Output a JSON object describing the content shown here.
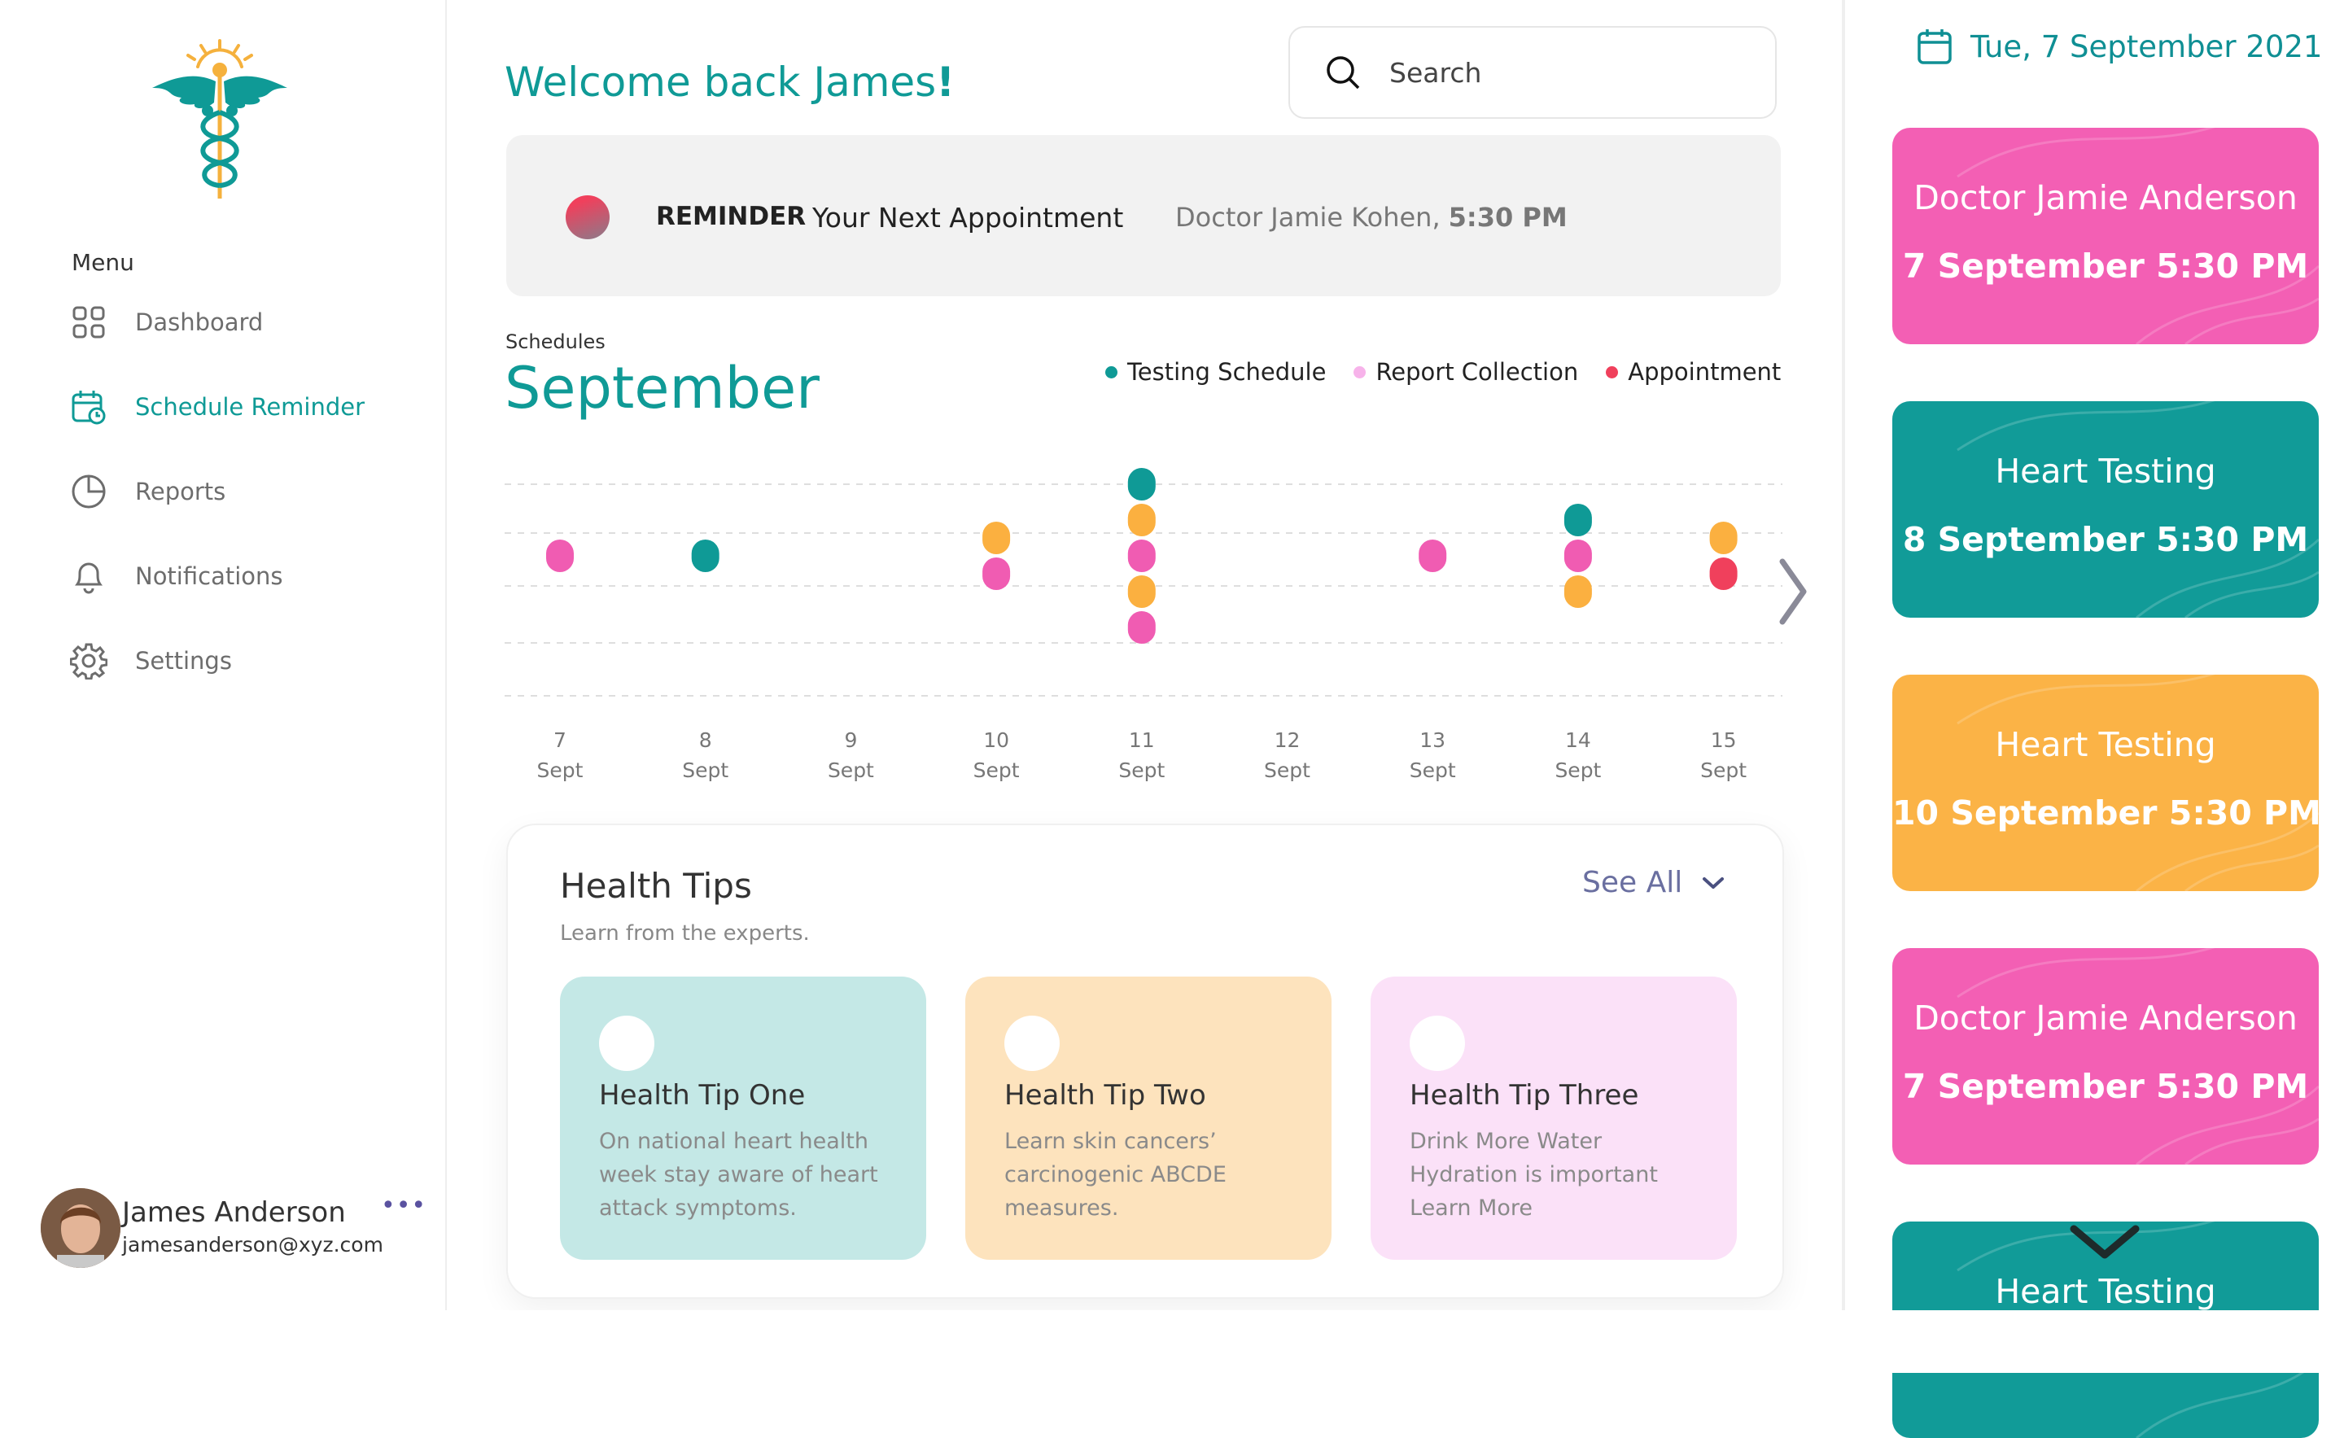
{
  "sidebar": {
    "menu_label": "Menu",
    "items": [
      {
        "label": "Dashboard",
        "icon": "grid-icon"
      },
      {
        "label": "Schedule Reminder",
        "icon": "calendar-clock-icon",
        "active": true
      },
      {
        "label": "Reports",
        "icon": "pie-chart-icon"
      },
      {
        "label": "Notifications",
        "icon": "bell-icon"
      },
      {
        "label": "Settings",
        "icon": "gear-icon"
      }
    ],
    "profile": {
      "name": "James Anderson",
      "email": "jamesanderson@xyz.com",
      "more": "•••"
    }
  },
  "header": {
    "welcome": "Welcome back James",
    "welcome_excl": "!",
    "search_placeholder": "Search"
  },
  "reminder": {
    "tag": "REMINDER",
    "text": "Your Next Appointment",
    "doctor": "Doctor Jamie Kohen,",
    "time": "5:30 PM"
  },
  "schedules": {
    "label": "Schedules",
    "month": "September",
    "legend": [
      {
        "label": "Testing Schedule",
        "color": "#0f9a96"
      },
      {
        "label": "Report Collection",
        "color": "#f29fe0"
      },
      {
        "label": "Appointment",
        "color": "#f0405c"
      }
    ]
  },
  "chart_data": {
    "type": "scatter",
    "x_days": [
      "7",
      "8",
      "9",
      "10",
      "11",
      "12",
      "13",
      "14",
      "15"
    ],
    "x_unit": "Sept",
    "colors": {
      "teal": "#0f9a96",
      "pink": "#f05cb2",
      "orange": "#fbb040",
      "red": "#f0405c"
    },
    "events": [
      {
        "day": "7",
        "stack": [
          "pink"
        ]
      },
      {
        "day": "8",
        "stack": [
          "teal"
        ]
      },
      {
        "day": "9",
        "stack": []
      },
      {
        "day": "10",
        "stack": [
          "orange",
          "pink"
        ]
      },
      {
        "day": "11",
        "stack": [
          "teal",
          "orange",
          "pink",
          "orange",
          "pink"
        ]
      },
      {
        "day": "12",
        "stack": []
      },
      {
        "day": "13",
        "stack": [
          "pink"
        ]
      },
      {
        "day": "14",
        "stack": [
          "teal",
          "pink",
          "orange"
        ]
      },
      {
        "day": "15",
        "stack": [
          "orange",
          "red"
        ]
      }
    ]
  },
  "health_tips": {
    "title": "Health Tips",
    "subtitle": "Learn from the experts.",
    "see_all": "See All",
    "cards": [
      {
        "title": "Health Tip One",
        "lines": [
          "On national heart health",
          "week stay aware of heart",
          "attack symptoms."
        ],
        "bg": "#c4e8e6"
      },
      {
        "title": "Health Tip Two",
        "lines": [
          "Learn skin cancers’",
          "carcinogenic ABCDE",
          "measures."
        ],
        "bg": "#fde3bd"
      },
      {
        "title": "Health Tip Three",
        "lines": [
          "Drink More Water",
          "Hydration is important",
          "Learn More"
        ],
        "bg": "#fbe1f8"
      }
    ]
  },
  "right_panel": {
    "date": "Tue, 7 September 2021",
    "appointments": [
      {
        "title": "Doctor Jamie Anderson",
        "date": "7 September 5:30 PM",
        "color": "#f35fb4"
      },
      {
        "title": "Heart Testing",
        "date": "8 September 5:30 PM",
        "color": "#119b98"
      },
      {
        "title": "Heart Testing",
        "date": "10 September 5:30 PM",
        "color": "#fbb346"
      },
      {
        "title": "Doctor Jamie Anderson",
        "date": "7 September 5:30 PM",
        "color": "#f35fb4"
      },
      {
        "title": "Heart Testing",
        "date": "",
        "color": "#119b98"
      }
    ]
  }
}
